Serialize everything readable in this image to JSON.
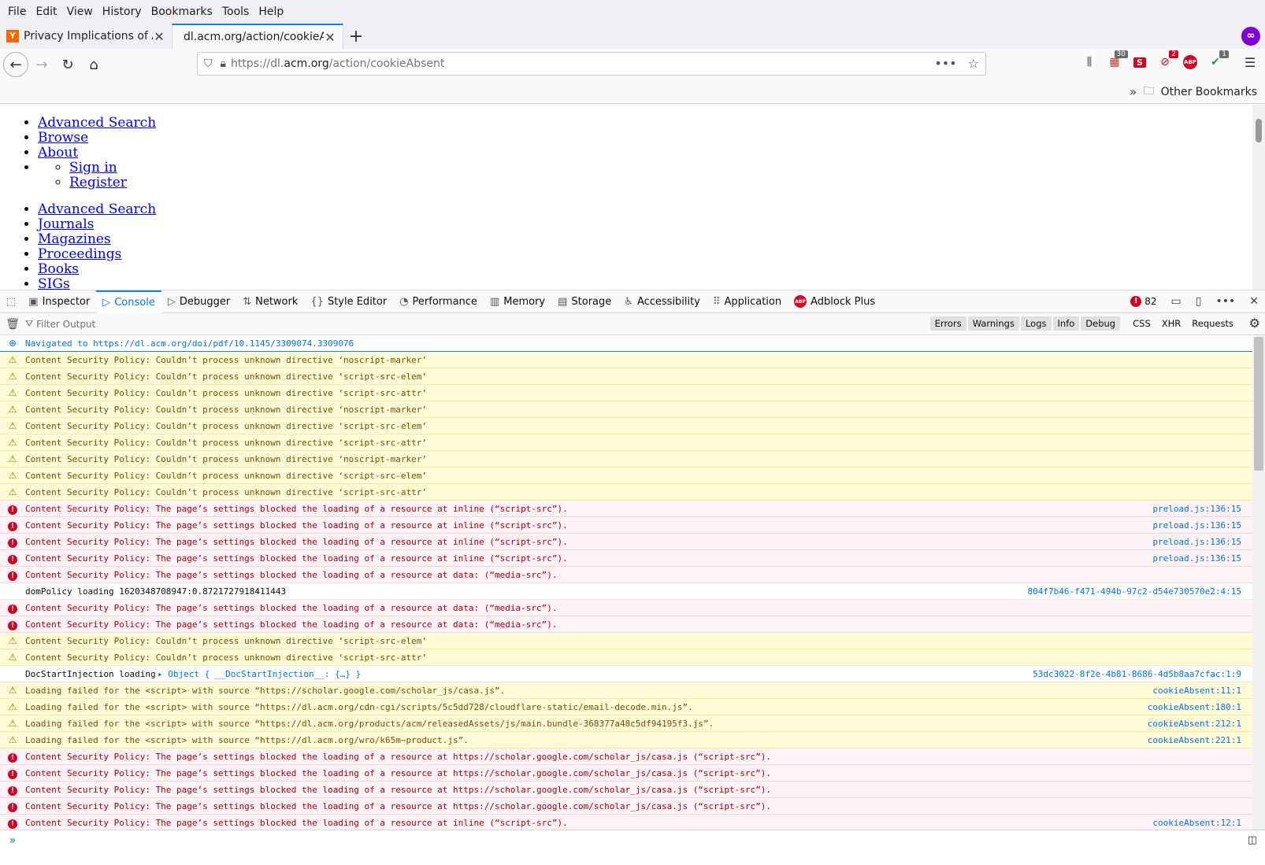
{
  "menu": [
    "File",
    "Edit",
    "View",
    "History",
    "Bookmarks",
    "Tools",
    "Help"
  ],
  "tabs": [
    {
      "title": "Privacy Implications of Acc",
      "favicon": "Y"
    },
    {
      "title": "dl.acm.org/action/cookieAbsent"
    }
  ],
  "url": {
    "prefix": "https://dl.",
    "domain": "acm.org",
    "path": "/action/cookieAbsent"
  },
  "toolbar_badges": {
    "ext1": "30",
    "ext2": "2",
    "ext3": "1"
  },
  "bookmarks": {
    "other": "Other Bookmarks"
  },
  "page": {
    "list1": [
      "Advanced Search",
      "Browse",
      "About"
    ],
    "inner": [
      "Sign in",
      "Register"
    ],
    "list2": [
      "Advanced Search",
      "Journals",
      "Magazines",
      "Proceedings",
      "Books",
      "SIGs"
    ]
  },
  "devtools": {
    "tabs": [
      "Inspector",
      "Console",
      "Debugger",
      "Network",
      "Style Editor",
      "Performance",
      "Memory",
      "Storage",
      "Accessibility",
      "Application",
      "Adblock Plus"
    ],
    "error_count": "82",
    "filter_placeholder": "Filter Output",
    "filters": [
      "Errors",
      "Warnings",
      "Logs",
      "Info",
      "Debug"
    ],
    "filters2": [
      "CSS",
      "XHR",
      "Requests"
    ]
  },
  "console": [
    {
      "type": "nav",
      "msg": "Navigated to https://dl.acm.org/doi/pdf/10.1145/3309074.3309076",
      "loc": ""
    },
    {
      "type": "warn",
      "msg": "Content Security Policy: Couldn’t process unknown directive ‘noscript-marker’",
      "loc": ""
    },
    {
      "type": "warn",
      "msg": "Content Security Policy: Couldn’t process unknown directive ‘script-src-elem’",
      "loc": ""
    },
    {
      "type": "warn",
      "msg": "Content Security Policy: Couldn’t process unknown directive ‘script-src-attr’",
      "loc": ""
    },
    {
      "type": "warn",
      "msg": "Content Security Policy: Couldn’t process unknown directive ‘noscript-marker’",
      "loc": ""
    },
    {
      "type": "warn",
      "msg": "Content Security Policy: Couldn’t process unknown directive ‘script-src-elem’",
      "loc": ""
    },
    {
      "type": "warn",
      "msg": "Content Security Policy: Couldn’t process unknown directive ‘script-src-attr’",
      "loc": ""
    },
    {
      "type": "warn",
      "msg": "Content Security Policy: Couldn’t process unknown directive ‘noscript-marker’",
      "loc": ""
    },
    {
      "type": "warn",
      "msg": "Content Security Policy: Couldn’t process unknown directive ‘script-src-elem’",
      "loc": ""
    },
    {
      "type": "warn",
      "msg": "Content Security Policy: Couldn’t process unknown directive ‘script-src-attr’",
      "loc": ""
    },
    {
      "type": "error",
      "msg": "Content Security Policy: The page’s settings blocked the loading of a resource at inline (“script-src”).",
      "loc": "preload.js:136:15"
    },
    {
      "type": "error",
      "msg": "Content Security Policy: The page’s settings blocked the loading of a resource at inline (“script-src”).",
      "loc": "preload.js:136:15"
    },
    {
      "type": "error",
      "msg": "Content Security Policy: The page’s settings blocked the loading of a resource at inline (“script-src”).",
      "loc": "preload.js:136:15"
    },
    {
      "type": "error",
      "msg": "Content Security Policy: The page’s settings blocked the loading of a resource at inline (“script-src”).",
      "loc": "preload.js:136:15"
    },
    {
      "type": "error",
      "msg": "Content Security Policy: The page’s settings blocked the loading of a resource at data: (“media-src”).",
      "loc": ""
    },
    {
      "type": "log",
      "msg": "domPolicy loading 1620348708947:0.8721727918411443",
      "loc": "804f7b46-f471-494b-97c2-d54e730570e2:4:15"
    },
    {
      "type": "error",
      "msg": "Content Security Policy: The page’s settings blocked the loading of a resource at data: (“media-src”).",
      "loc": ""
    },
    {
      "type": "error",
      "msg": "Content Security Policy: The page’s settings blocked the loading of a resource at data: (“media-src”).",
      "loc": ""
    },
    {
      "type": "warn",
      "msg": "Content Security Policy: Couldn’t process unknown directive ‘script-src-elem’",
      "loc": ""
    },
    {
      "type": "warn",
      "msg": "Content Security Policy: Couldn’t process unknown directive ‘script-src-attr’",
      "loc": ""
    },
    {
      "type": "log",
      "msg": "DocStartInjection loading ",
      "obj": "▸ Object { __DocStartInjection__: {…} }",
      "loc": "53dc3022-8f2e-4b81-8686-4d5b8aa7cfac:1:9"
    },
    {
      "type": "warn",
      "msg": "Loading failed for the <script> with source “https://scholar.google.com/scholar_js/casa.js”.",
      "loc": "cookieAbsent:11:1"
    },
    {
      "type": "warn",
      "msg": "Loading failed for the <script> with source “https://dl.acm.org/cdn-cgi/scripts/5c5dd728/cloudflare-static/email-decode.min.js”.",
      "loc": "cookieAbsent:180:1"
    },
    {
      "type": "warn",
      "msg": "Loading failed for the <script> with source “https://dl.acm.org/products/acm/releasedAssets/js/main.bundle-368377a48c5df94195f3.js”.",
      "loc": "cookieAbsent:212:1"
    },
    {
      "type": "warn",
      "msg": "Loading failed for the <script> with source “https://dl.acm.org/wro/k65m~product.js”.",
      "loc": "cookieAbsent:221:1"
    },
    {
      "type": "error",
      "msg": "Content Security Policy: The page’s settings blocked the loading of a resource at https://scholar.google.com/scholar_js/casa.js (“script-src”).",
      "loc": ""
    },
    {
      "type": "error",
      "msg": "Content Security Policy: The page’s settings blocked the loading of a resource at https://scholar.google.com/scholar_js/casa.js (“script-src”).",
      "loc": ""
    },
    {
      "type": "error",
      "msg": "Content Security Policy: The page’s settings blocked the loading of a resource at https://scholar.google.com/scholar_js/casa.js (“script-src”).",
      "loc": ""
    },
    {
      "type": "error",
      "msg": "Content Security Policy: The page’s settings blocked the loading of a resource at https://scholar.google.com/scholar_js/casa.js (“script-src”).",
      "loc": ""
    },
    {
      "type": "error",
      "msg": "Content Security Policy: The page’s settings blocked the loading of a resource at inline (“script-src”).",
      "loc": "cookieAbsent:12:1"
    }
  ]
}
